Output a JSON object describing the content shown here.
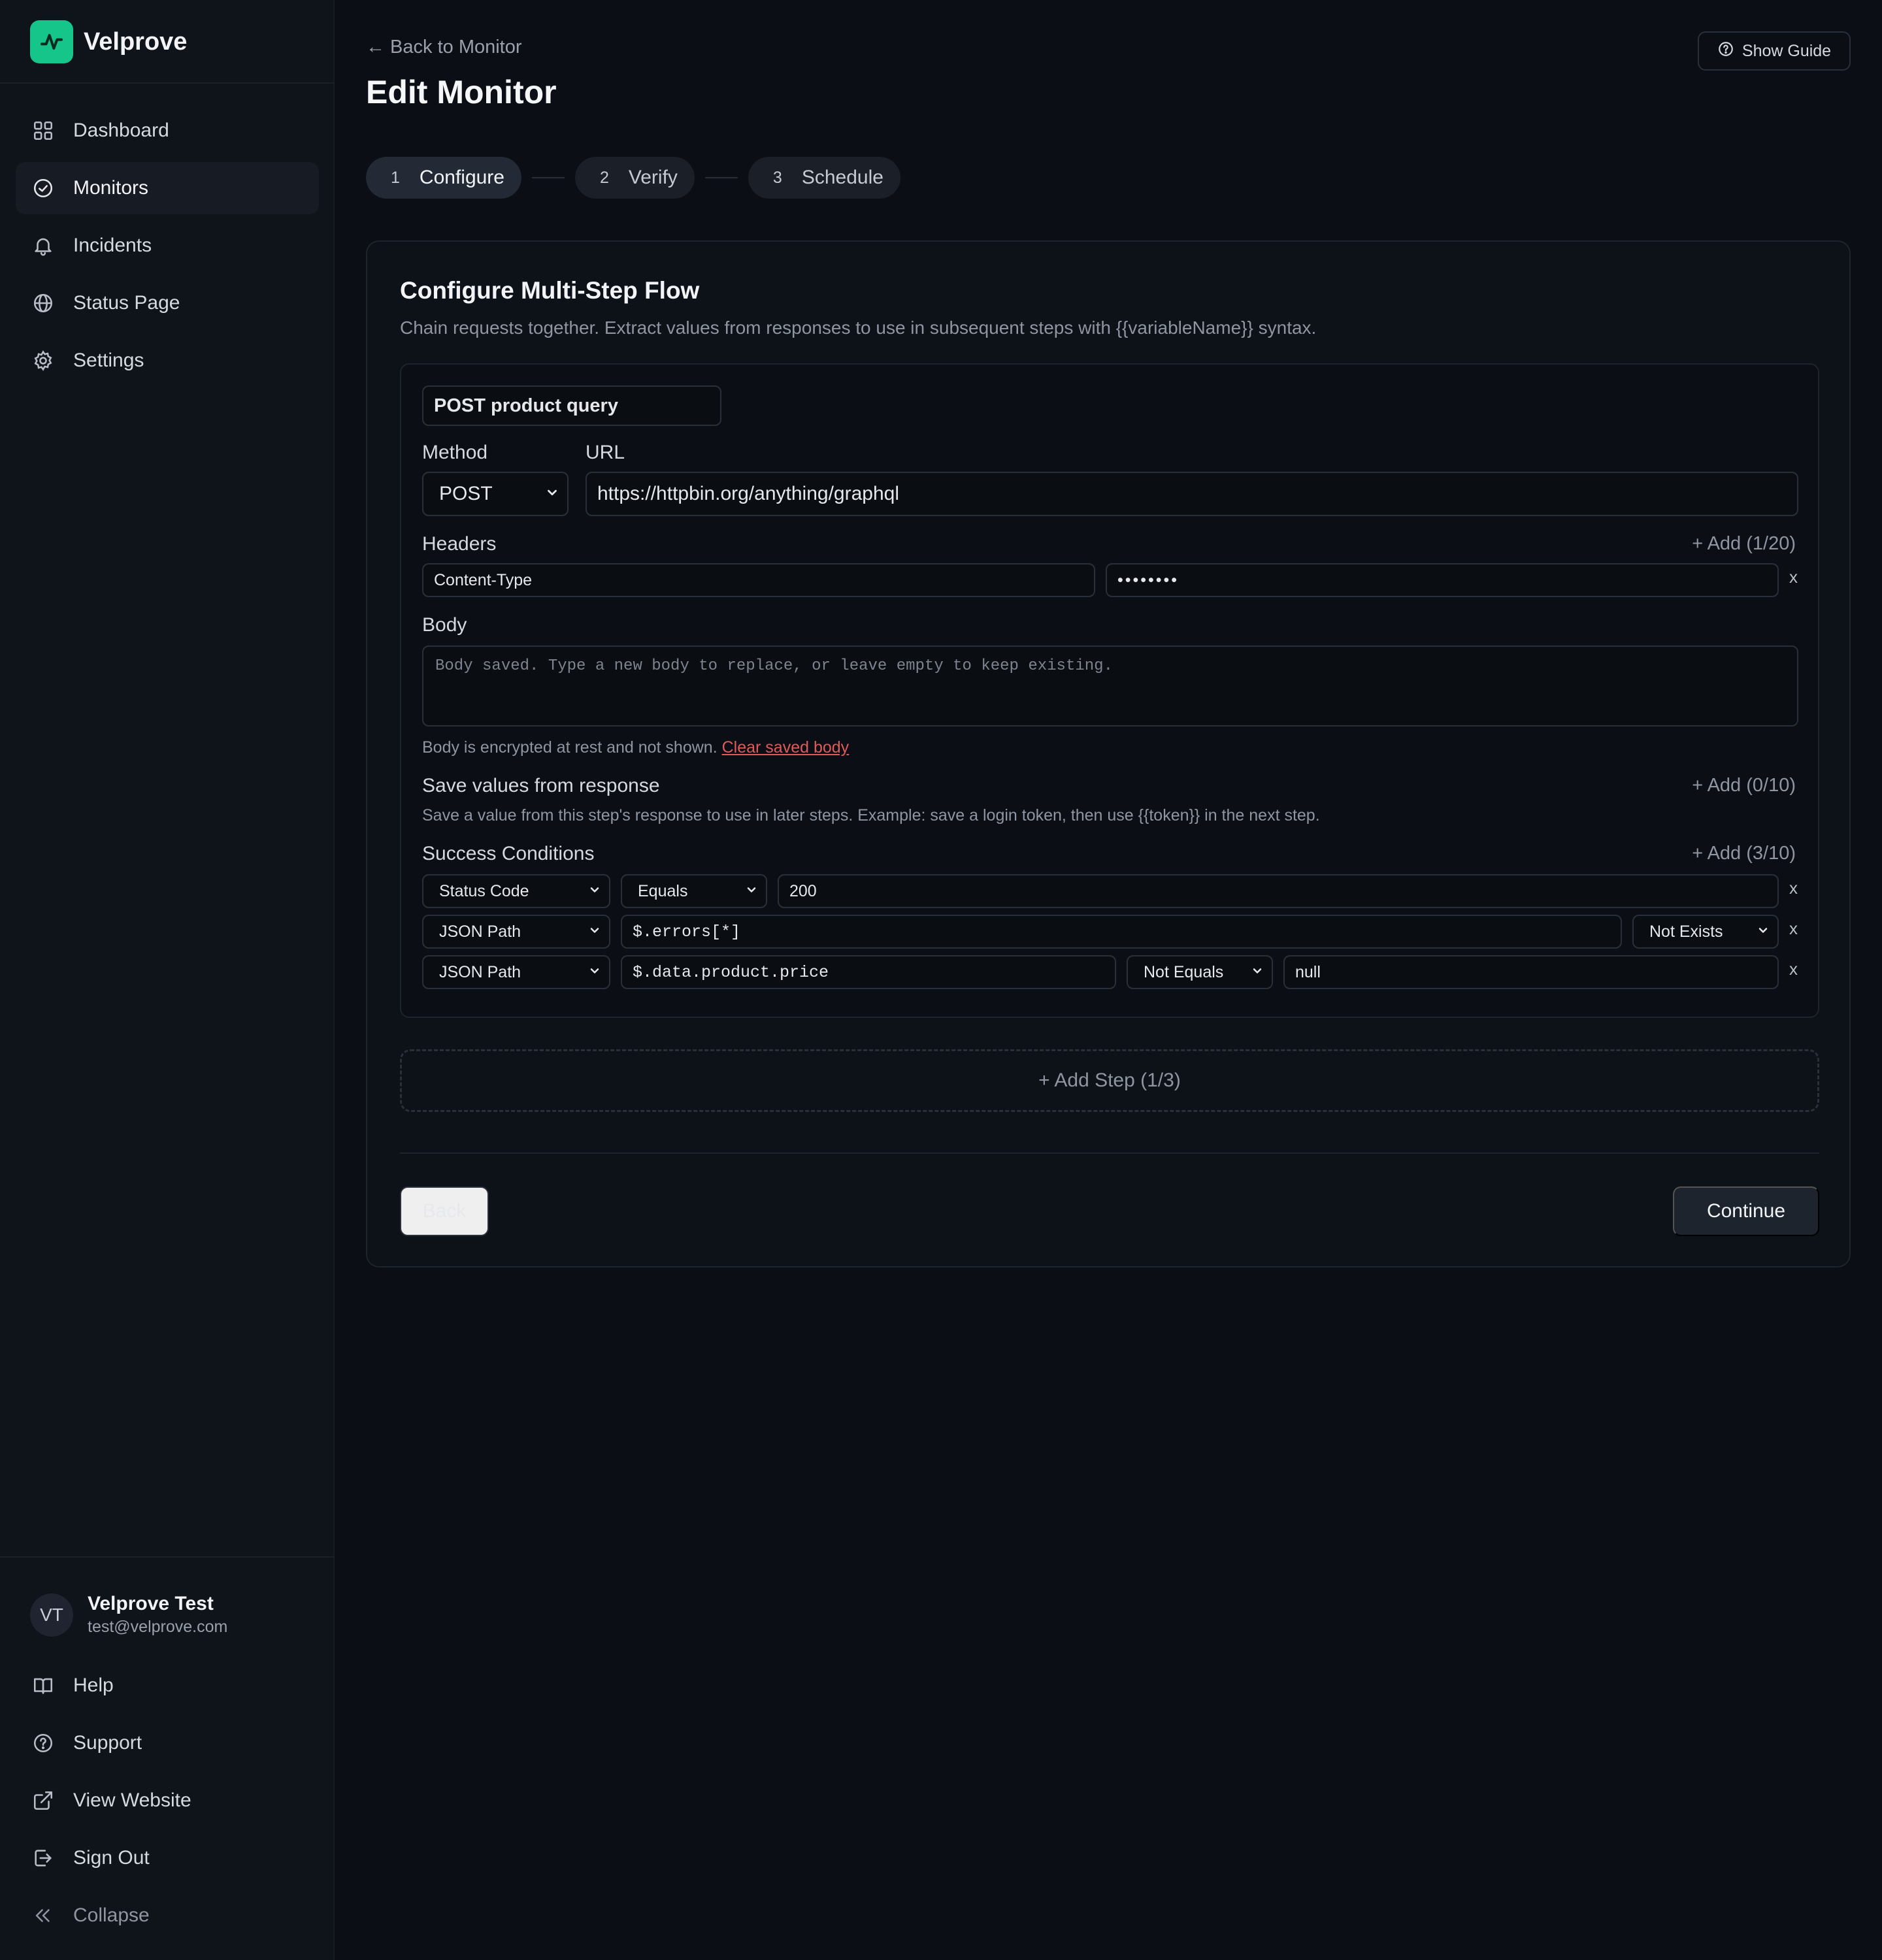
{
  "brand": {
    "name": "Velprove",
    "logo_icon": "pulse-icon",
    "logo_color": "#16c58a"
  },
  "sidebar": {
    "items": [
      {
        "label": "Dashboard",
        "icon": "grid-icon",
        "active": false
      },
      {
        "label": "Monitors",
        "icon": "check-circle-icon",
        "active": true
      },
      {
        "label": "Incidents",
        "icon": "bell-icon",
        "active": false
      },
      {
        "label": "Status Page",
        "icon": "globe-icon",
        "active": false
      },
      {
        "label": "Settings",
        "icon": "gear-icon",
        "active": false
      }
    ],
    "user": {
      "initials": "VT",
      "name": "Velprove Test",
      "email": "test@velprove.com"
    },
    "bottom_items": [
      {
        "label": "Help",
        "icon": "book-icon"
      },
      {
        "label": "Support",
        "icon": "question-circle-icon"
      },
      {
        "label": "View Website",
        "icon": "external-link-icon"
      },
      {
        "label": "Sign Out",
        "icon": "sign-out-icon"
      },
      {
        "label": "Collapse",
        "icon": "chevrons-left-icon"
      }
    ]
  },
  "header": {
    "back_link": "← Back to Monitor",
    "title": "Edit Monitor",
    "guide_button": "Show Guide"
  },
  "stepper": [
    {
      "num": "1",
      "label": "Configure",
      "active": true
    },
    {
      "num": "2",
      "label": "Verify",
      "active": false
    },
    {
      "num": "3",
      "label": "Schedule",
      "active": false
    }
  ],
  "card": {
    "title": "Configure Multi-Step Flow",
    "description": "Chain requests together. Extract values from responses to use in subsequent steps with {{variableName}} syntax."
  },
  "step": {
    "name": "POST product query",
    "method_label": "Method",
    "method_value": "POST",
    "url_label": "URL",
    "url_value": "https://httpbin.org/anything/graphql",
    "headers_label": "Headers",
    "headers_add": "+ Add (1/20)",
    "header_key": "Content-Type",
    "header_value": "••••••••",
    "remove": "x",
    "body_label": "Body",
    "body_placeholder": "Body saved. Type a new body to replace, or leave empty to keep existing.",
    "body_note": "Body is encrypted at rest and not shown.",
    "body_clear": "Clear saved body",
    "save_label": "Save values from response",
    "save_add": "+ Add (0/10)",
    "save_hint": "Save a value from this step's response to use in later steps. Example: save a login token, then use {{token}} in the next step.",
    "conditions_label": "Success Conditions",
    "conditions_add": "+ Add (3/10)",
    "conditions": [
      {
        "type": "Status Code",
        "op": "Equals",
        "value": "200"
      },
      {
        "type": "JSON Path",
        "path": "$.errors[*]",
        "op": "Not Exists"
      },
      {
        "type": "JSON Path",
        "path": "$.data.product.price",
        "op": "Not Equals",
        "value": "null"
      }
    ]
  },
  "add_step": "+ Add Step (1/3)",
  "footer": {
    "back": "Back",
    "continue": "Continue"
  }
}
